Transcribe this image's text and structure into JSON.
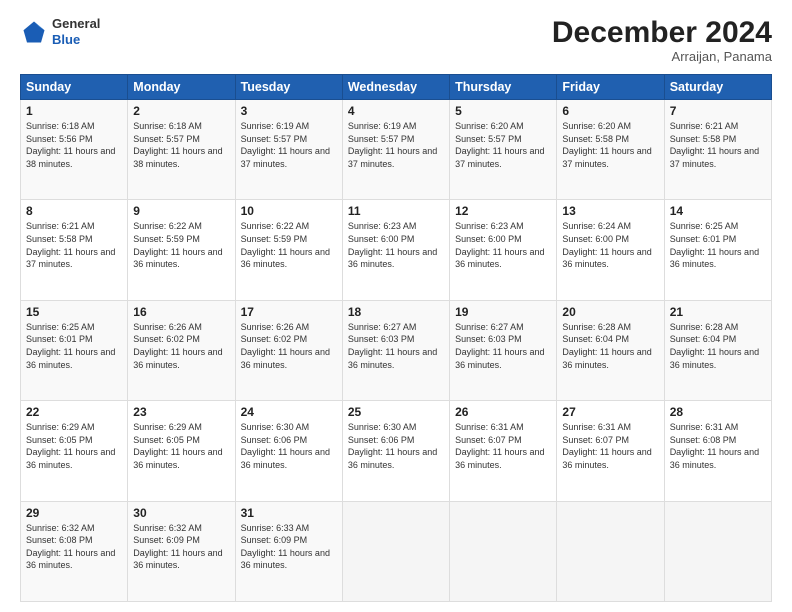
{
  "header": {
    "logo": {
      "line1": "General",
      "line2": "Blue"
    },
    "title": "December 2024",
    "subtitle": "Arraijan, Panama"
  },
  "weekdays": [
    "Sunday",
    "Monday",
    "Tuesday",
    "Wednesday",
    "Thursday",
    "Friday",
    "Saturday"
  ],
  "weeks": [
    [
      {
        "day": "1",
        "sunrise": "Sunrise: 6:18 AM",
        "sunset": "Sunset: 5:56 PM",
        "daylight": "Daylight: 11 hours and 38 minutes."
      },
      {
        "day": "2",
        "sunrise": "Sunrise: 6:18 AM",
        "sunset": "Sunset: 5:57 PM",
        "daylight": "Daylight: 11 hours and 38 minutes."
      },
      {
        "day": "3",
        "sunrise": "Sunrise: 6:19 AM",
        "sunset": "Sunset: 5:57 PM",
        "daylight": "Daylight: 11 hours and 37 minutes."
      },
      {
        "day": "4",
        "sunrise": "Sunrise: 6:19 AM",
        "sunset": "Sunset: 5:57 PM",
        "daylight": "Daylight: 11 hours and 37 minutes."
      },
      {
        "day": "5",
        "sunrise": "Sunrise: 6:20 AM",
        "sunset": "Sunset: 5:57 PM",
        "daylight": "Daylight: 11 hours and 37 minutes."
      },
      {
        "day": "6",
        "sunrise": "Sunrise: 6:20 AM",
        "sunset": "Sunset: 5:58 PM",
        "daylight": "Daylight: 11 hours and 37 minutes."
      },
      {
        "day": "7",
        "sunrise": "Sunrise: 6:21 AM",
        "sunset": "Sunset: 5:58 PM",
        "daylight": "Daylight: 11 hours and 37 minutes."
      }
    ],
    [
      {
        "day": "8",
        "sunrise": "Sunrise: 6:21 AM",
        "sunset": "Sunset: 5:58 PM",
        "daylight": "Daylight: 11 hours and 37 minutes."
      },
      {
        "day": "9",
        "sunrise": "Sunrise: 6:22 AM",
        "sunset": "Sunset: 5:59 PM",
        "daylight": "Daylight: 11 hours and 36 minutes."
      },
      {
        "day": "10",
        "sunrise": "Sunrise: 6:22 AM",
        "sunset": "Sunset: 5:59 PM",
        "daylight": "Daylight: 11 hours and 36 minutes."
      },
      {
        "day": "11",
        "sunrise": "Sunrise: 6:23 AM",
        "sunset": "Sunset: 6:00 PM",
        "daylight": "Daylight: 11 hours and 36 minutes."
      },
      {
        "day": "12",
        "sunrise": "Sunrise: 6:23 AM",
        "sunset": "Sunset: 6:00 PM",
        "daylight": "Daylight: 11 hours and 36 minutes."
      },
      {
        "day": "13",
        "sunrise": "Sunrise: 6:24 AM",
        "sunset": "Sunset: 6:00 PM",
        "daylight": "Daylight: 11 hours and 36 minutes."
      },
      {
        "day": "14",
        "sunrise": "Sunrise: 6:25 AM",
        "sunset": "Sunset: 6:01 PM",
        "daylight": "Daylight: 11 hours and 36 minutes."
      }
    ],
    [
      {
        "day": "15",
        "sunrise": "Sunrise: 6:25 AM",
        "sunset": "Sunset: 6:01 PM",
        "daylight": "Daylight: 11 hours and 36 minutes."
      },
      {
        "day": "16",
        "sunrise": "Sunrise: 6:26 AM",
        "sunset": "Sunset: 6:02 PM",
        "daylight": "Daylight: 11 hours and 36 minutes."
      },
      {
        "day": "17",
        "sunrise": "Sunrise: 6:26 AM",
        "sunset": "Sunset: 6:02 PM",
        "daylight": "Daylight: 11 hours and 36 minutes."
      },
      {
        "day": "18",
        "sunrise": "Sunrise: 6:27 AM",
        "sunset": "Sunset: 6:03 PM",
        "daylight": "Daylight: 11 hours and 36 minutes."
      },
      {
        "day": "19",
        "sunrise": "Sunrise: 6:27 AM",
        "sunset": "Sunset: 6:03 PM",
        "daylight": "Daylight: 11 hours and 36 minutes."
      },
      {
        "day": "20",
        "sunrise": "Sunrise: 6:28 AM",
        "sunset": "Sunset: 6:04 PM",
        "daylight": "Daylight: 11 hours and 36 minutes."
      },
      {
        "day": "21",
        "sunrise": "Sunrise: 6:28 AM",
        "sunset": "Sunset: 6:04 PM",
        "daylight": "Daylight: 11 hours and 36 minutes."
      }
    ],
    [
      {
        "day": "22",
        "sunrise": "Sunrise: 6:29 AM",
        "sunset": "Sunset: 6:05 PM",
        "daylight": "Daylight: 11 hours and 36 minutes."
      },
      {
        "day": "23",
        "sunrise": "Sunrise: 6:29 AM",
        "sunset": "Sunset: 6:05 PM",
        "daylight": "Daylight: 11 hours and 36 minutes."
      },
      {
        "day": "24",
        "sunrise": "Sunrise: 6:30 AM",
        "sunset": "Sunset: 6:06 PM",
        "daylight": "Daylight: 11 hours and 36 minutes."
      },
      {
        "day": "25",
        "sunrise": "Sunrise: 6:30 AM",
        "sunset": "Sunset: 6:06 PM",
        "daylight": "Daylight: 11 hours and 36 minutes."
      },
      {
        "day": "26",
        "sunrise": "Sunrise: 6:31 AM",
        "sunset": "Sunset: 6:07 PM",
        "daylight": "Daylight: 11 hours and 36 minutes."
      },
      {
        "day": "27",
        "sunrise": "Sunrise: 6:31 AM",
        "sunset": "Sunset: 6:07 PM",
        "daylight": "Daylight: 11 hours and 36 minutes."
      },
      {
        "day": "28",
        "sunrise": "Sunrise: 6:31 AM",
        "sunset": "Sunset: 6:08 PM",
        "daylight": "Daylight: 11 hours and 36 minutes."
      }
    ],
    [
      {
        "day": "29",
        "sunrise": "Sunrise: 6:32 AM",
        "sunset": "Sunset: 6:08 PM",
        "daylight": "Daylight: 11 hours and 36 minutes."
      },
      {
        "day": "30",
        "sunrise": "Sunrise: 6:32 AM",
        "sunset": "Sunset: 6:09 PM",
        "daylight": "Daylight: 11 hours and 36 minutes."
      },
      {
        "day": "31",
        "sunrise": "Sunrise: 6:33 AM",
        "sunset": "Sunset: 6:09 PM",
        "daylight": "Daylight: 11 hours and 36 minutes."
      },
      null,
      null,
      null,
      null
    ]
  ]
}
